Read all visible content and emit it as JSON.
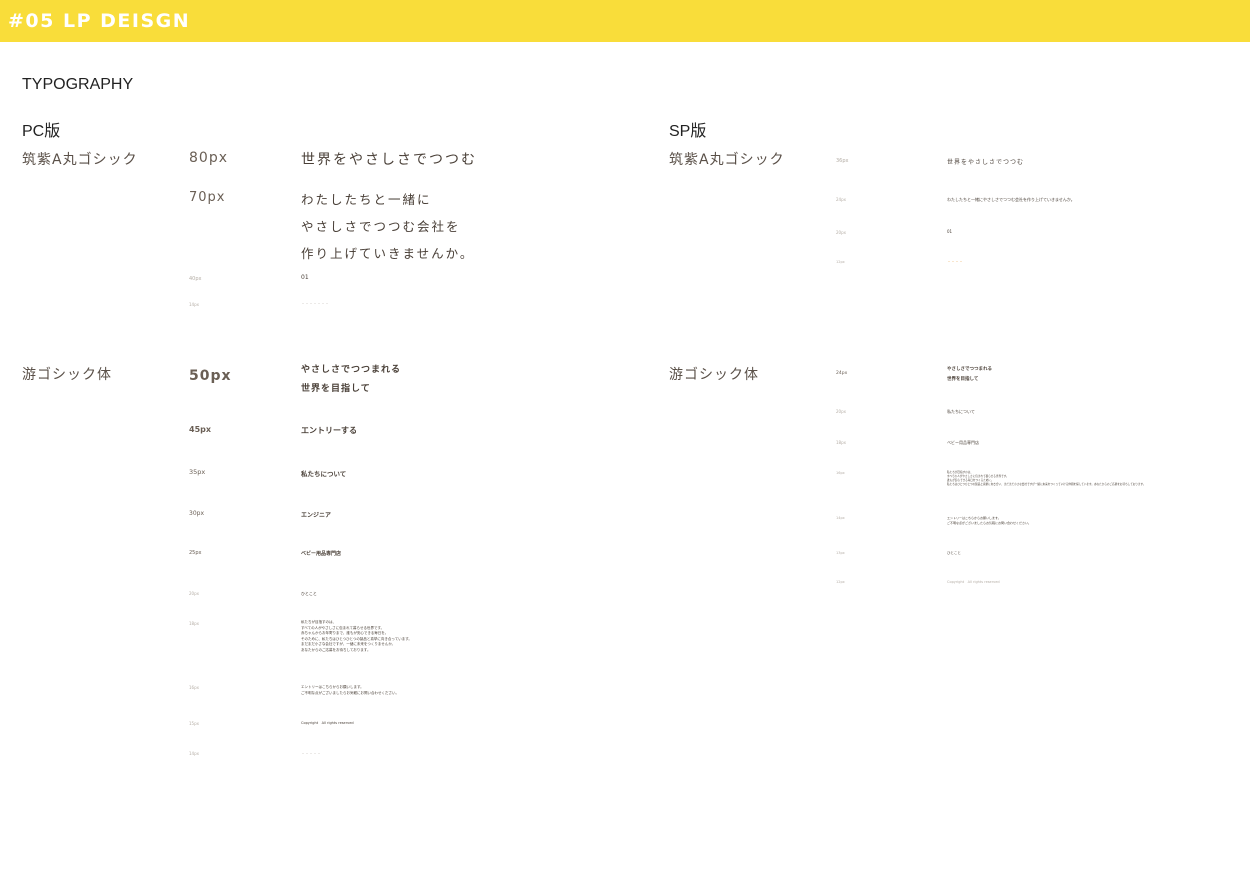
{
  "header": {
    "title": "#05 LP DEISGN"
  },
  "section_title": "TYPOGRAPHY",
  "pc": {
    "label": "PC版",
    "maru": {
      "font": "筑紫A丸ゴシック",
      "rows": [
        {
          "size": "80px",
          "text": [
            "世界をやさしさでつつむ"
          ]
        },
        {
          "size": "70px",
          "text": [
            "わたしたちと一緒に",
            "やさしさでつつむ会社を",
            "作り上げていきませんか。"
          ]
        },
        {
          "size": "40px",
          "text": [
            "01"
          ]
        },
        {
          "size": "14px",
          "text": [
            "・・・・・・・"
          ]
        }
      ]
    },
    "yu": {
      "font": "游ゴシック体",
      "rows": [
        {
          "size": "50px",
          "text": [
            "やさしさでつつまれる",
            "世界を目指して"
          ]
        },
        {
          "size": "45px",
          "text": [
            "エントリーする"
          ]
        },
        {
          "size": "35px",
          "text": [
            "私たちについて"
          ]
        },
        {
          "size": "30px",
          "text": [
            "エンジニア"
          ]
        },
        {
          "size": "25px",
          "text": [
            "ベビー用品専門店"
          ]
        },
        {
          "size": "20px",
          "text": [
            "ひとこと"
          ]
        },
        {
          "size": "18px",
          "text": [
            "私たちが目指すのは、",
            "すべての人がやさしさに包まれて暮らせる世界です。",
            "赤ちゃんからお年寄りまで、誰もが安心できる毎日を。",
            "そのために、私たちはひとつひとつの製品と真摯に向き合っています。",
            "まだまだ小さな会社ですが、一緒に未来をつくりませんか。",
            "あなたからのご応募をお待ちしております。"
          ]
        },
        {
          "size": "16px",
          "text": [
            "エントリーはこちらからお願いします。",
            "ご不明な点がございましたらお気軽にお問い合わせください。"
          ]
        },
        {
          "size": "15px",
          "text": [
            "Copyright　All rights reserved"
          ]
        },
        {
          "size": "14px",
          "text": [
            "・・・・・"
          ]
        }
      ]
    }
  },
  "sp": {
    "label": "SP版",
    "maru": {
      "font": "筑紫A丸ゴシック",
      "rows": [
        {
          "size": "36px",
          "text": [
            "世界をやさしさでつつむ"
          ]
        },
        {
          "size": "24px",
          "text": [
            "わたしたちと一緒にやさしさでつつむ会社を作り上げていきませんか。"
          ]
        },
        {
          "size": "20px",
          "text": [
            "01"
          ]
        },
        {
          "size": "12px",
          "text": [
            "・・・・"
          ]
        }
      ]
    },
    "yu": {
      "font": "游ゴシック体",
      "rows": [
        {
          "size": "24px",
          "text": [
            "やさしさでつつまれる",
            "世界を目指して"
          ]
        },
        {
          "size": "20px",
          "text": [
            "私たちについて"
          ]
        },
        {
          "size": "18px",
          "text": [
            "ベビー用品専門店"
          ]
        },
        {
          "size": "16px",
          "text": [
            "私たちが目指すのは、",
            "すべての人がやさしさに包まれて暮らせる世界です。",
            "誰もが安心できる毎日をつくるために。",
            "私たちはひとつひとつの製品と真摯に向き合い、まだまだ小さな会社ですが一緒に未来をつくっていける仲間を探しています。あなたからのご応募をお待ちしております。"
          ]
        },
        {
          "size": "14px",
          "text": [
            "エントリーはこちらからお願いします。",
            "ご不明な点がございましたらお気軽にお問い合わせください。"
          ]
        },
        {
          "size": "13px",
          "text": [
            "ひとこと"
          ]
        },
        {
          "size": "12px",
          "text": [
            "Copyright　All rights reserved"
          ]
        }
      ]
    }
  }
}
